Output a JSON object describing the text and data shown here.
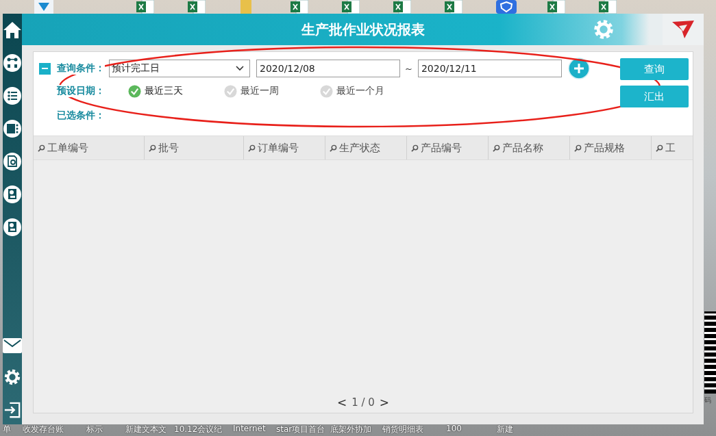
{
  "desktop": {
    "top_icons": [
      {
        "kind": "app"
      },
      {
        "kind": "excel"
      },
      {
        "kind": "excel"
      },
      {
        "kind": "folder"
      },
      {
        "kind": "excel"
      },
      {
        "kind": "excel"
      },
      {
        "kind": "excel"
      },
      {
        "kind": "excel"
      },
      {
        "kind": "shield"
      },
      {
        "kind": "excel"
      },
      {
        "kind": "excel"
      }
    ],
    "bottom_labels": [
      "单",
      "收发存台账",
      "标示",
      "新建文本文",
      "10.12会议纪",
      "Internet",
      "star项目首台",
      "底架外协加",
      "销货明细表",
      "100",
      "新建"
    ],
    "qr_caption": "码"
  },
  "window": {
    "title": "生产批作业状况报表"
  },
  "query": {
    "toggle_label": "查询条件：",
    "expanded": true,
    "field": "预计完工日",
    "date_from": "2020/12/08",
    "separator": "~",
    "date_to": "2020/12/11",
    "buttons": [
      "查询",
      "汇出"
    ],
    "preset_label": "预设日期：",
    "presets": [
      {
        "label": "最近三天",
        "selected": true
      },
      {
        "label": "最近一周",
        "selected": false
      },
      {
        "label": "最近一个月",
        "selected": false
      }
    ],
    "selected_label": "已选条件："
  },
  "table": {
    "columns": [
      "工单编号",
      "批号",
      "订单编号",
      "生产状态",
      "产品编号",
      "产品名称",
      "产品规格",
      "工"
    ]
  },
  "pager": {
    "prev": "<",
    "page": "1 / 0",
    "next": ">"
  }
}
